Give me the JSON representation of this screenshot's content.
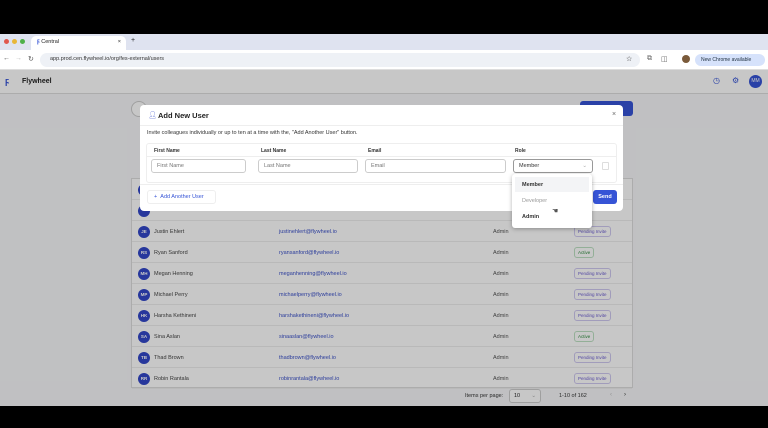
{
  "browser": {
    "tab_title": "Central",
    "url": "app.prod.cen.flywheel.io/org/fes-external/users",
    "new_chrome": "New Chrome available"
  },
  "app": {
    "name": "Flywheel",
    "avatar": "MM"
  },
  "users": [
    {
      "initials": "JE",
      "name": "Justin Ehlert",
      "email": "justinehlert@flywheel.io",
      "role": "Admin",
      "status": "Pending Invite"
    },
    {
      "initials": "RS",
      "name": "Ryan Sanford",
      "email": "ryansanford@flywheel.io",
      "role": "Admin",
      "status": "Active"
    },
    {
      "initials": "MH",
      "name": "Megan Henning",
      "email": "meganhenning@flywheel.io",
      "role": "Admin",
      "status": "Pending Invite"
    },
    {
      "initials": "MP",
      "name": "Michael Perry",
      "email": "michaelperry@flywheel.io",
      "role": "Admin",
      "status": "Pending Invite"
    },
    {
      "initials": "HK",
      "name": "Harsha Kethineni",
      "email": "harshakethineni@flywheel.io",
      "role": "Admin",
      "status": "Pending Invite"
    },
    {
      "initials": "SA",
      "name": "Sina Aslan",
      "email": "sinaaslan@flywheel.io",
      "role": "Admin",
      "status": "Active"
    },
    {
      "initials": "TB",
      "name": "Thad Brown",
      "email": "thadbrown@flywheel.io",
      "role": "Admin",
      "status": "Pending Invite"
    },
    {
      "initials": "RR",
      "name": "Robin Rantala",
      "email": "robinrantala@flywheel.io",
      "role": "Admin",
      "status": "Pending Invite"
    }
  ],
  "pagination": {
    "items_per_page_label": "Items per page:",
    "items_per_page": "10",
    "range": "1-10 of 162"
  },
  "modal": {
    "title": "Add New User",
    "description": "Invite colleagues individually or up to ten at a time with the, \"Add Another User\" button.",
    "headers": {
      "first": "First Name",
      "last": "Last Name",
      "email": "Email",
      "role": "Role"
    },
    "placeholders": {
      "first": "First Name",
      "last": "Last Name",
      "email": "Email"
    },
    "role_value": "Member",
    "add_another": "Add Another User",
    "send": "Send",
    "role_options": [
      "Member",
      "Developer",
      "Admin"
    ]
  },
  "colors": {
    "accent": "#3654d6"
  }
}
